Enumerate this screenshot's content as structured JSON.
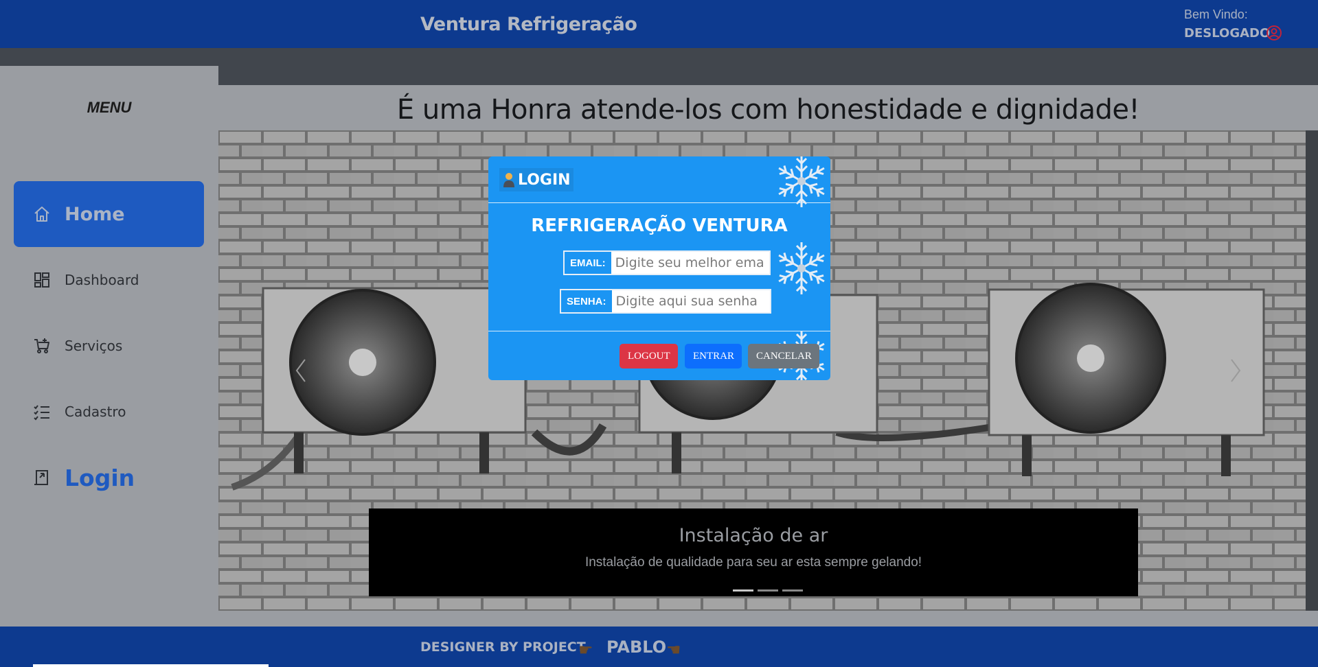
{
  "header": {
    "brand": "Ventura Refrigeração",
    "welcome": "Bem Vindo:",
    "status": "DESLOGADO"
  },
  "sidebar": {
    "title": "MENU",
    "items": [
      {
        "label": "Home",
        "icon": "home-icon"
      },
      {
        "label": "Dashboard",
        "icon": "dashboard-icon"
      },
      {
        "label": "Serviços",
        "icon": "cart-icon"
      },
      {
        "label": "Cadastro",
        "icon": "checklist-icon"
      },
      {
        "label": "Login",
        "icon": "login-icon"
      }
    ]
  },
  "main": {
    "headline": "É uma Honra atende-los com honestidade e dignidade!",
    "carousel": {
      "caption_title": "Instalação de ar",
      "caption_text": "Instalação de qualidade para seu ar esta sempre gelando!",
      "slides": 3,
      "active_slide": 1
    }
  },
  "login_modal": {
    "header": "LOGIN",
    "title": "REFRIGERAÇÃO VENTURA",
    "email_label": "EMAIL:",
    "email_placeholder": "Digite seu melhor email",
    "senha_label": "SENHA:",
    "senha_placeholder": "Digite aqui sua senha",
    "buttons": {
      "logout": "LOGOUT",
      "entrar": "ENTRAR",
      "cancelar": "CANCELAR"
    }
  },
  "footer": {
    "text": "DESIGNER BY PROJECT",
    "name": "PABLO"
  },
  "colors": {
    "header_bg": "#0d3a8f",
    "modal_bg": "#1b95f3",
    "active_nav": "#1e5ac0",
    "logout": "#dc3545",
    "entrar": "#0d6efd",
    "cancelar": "#6c757d"
  }
}
